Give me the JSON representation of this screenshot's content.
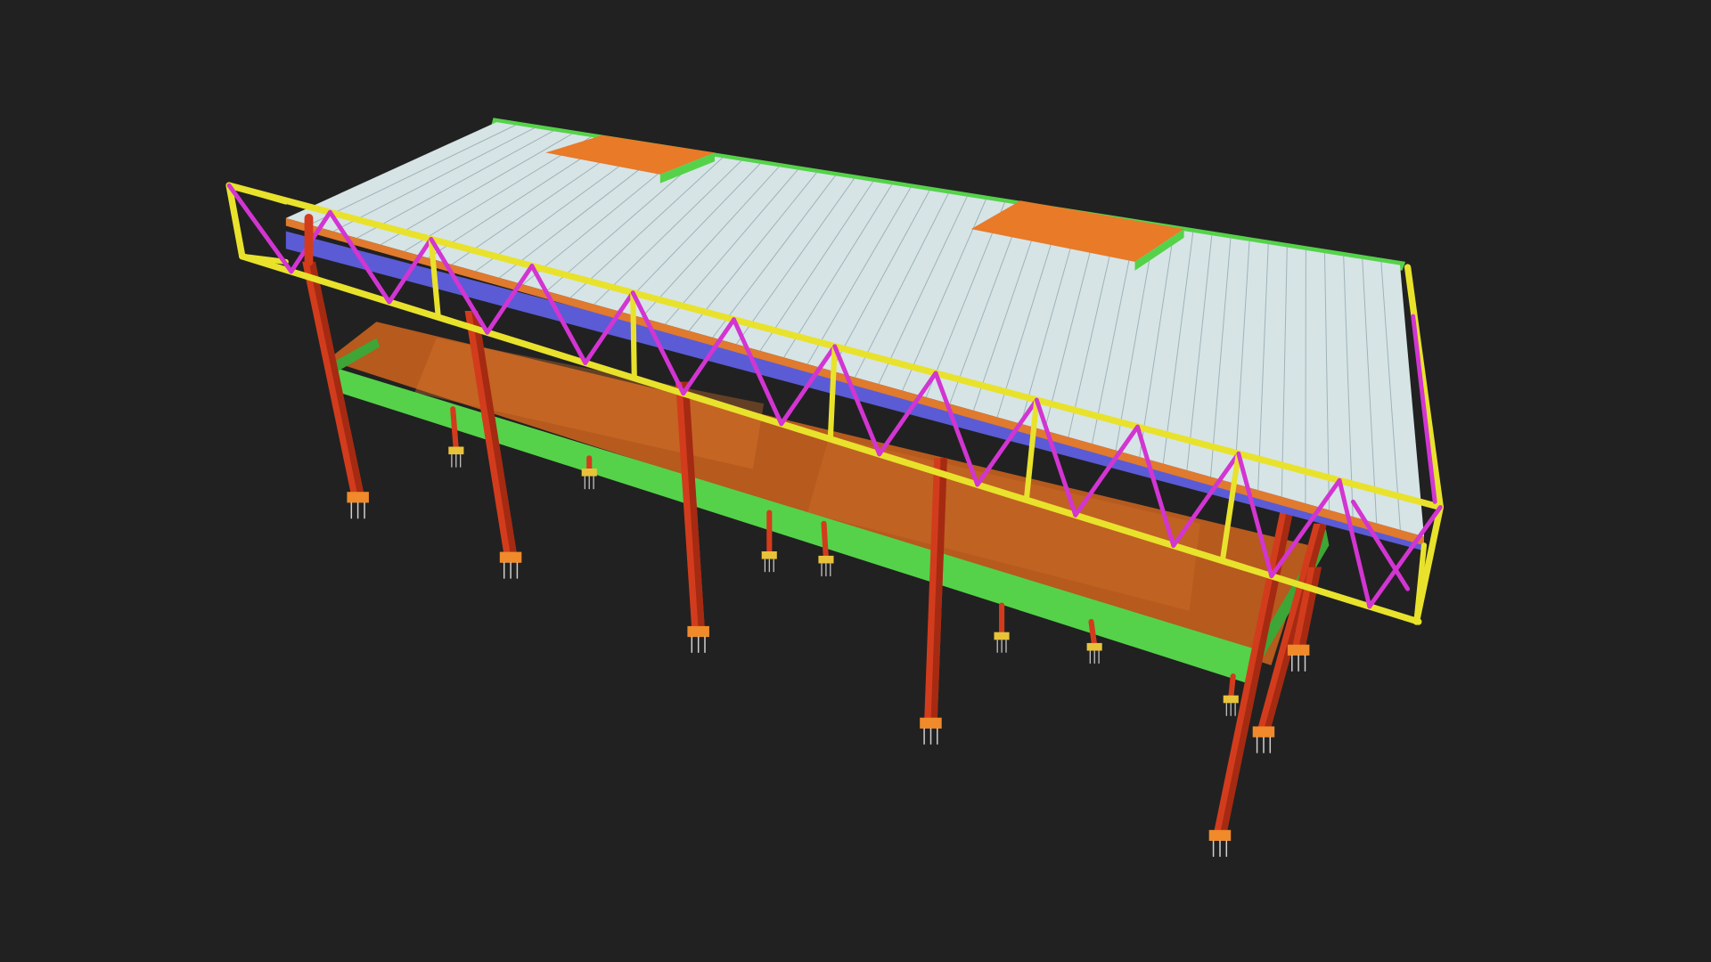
{
  "viewer": {
    "background_color": "#212121"
  },
  "model": {
    "colors": {
      "column": "#d23c1c",
      "column_dark": "#a52a12",
      "roof_panel": "#d6e4e6",
      "roof_panel_dark": "#c3d3d6",
      "roof_seam": "#9fb3b8",
      "truss_chord": "#e8e22c",
      "truss_web": "#d235d2",
      "edge_beam": "#55d24a",
      "edge_beam_dark": "#3ea636",
      "floor_slab": "#b65a1e",
      "floor_slab_light": "#e07a2e",
      "skylight": "#e87a28",
      "purlin": "#5b5bd6",
      "anchor": "#cfcfcf",
      "base_plate": "#f08a2a",
      "bracket": "#e8c33a"
    },
    "bay_count": 6,
    "roof_seam_count": 48,
    "skylight_count": 2
  }
}
